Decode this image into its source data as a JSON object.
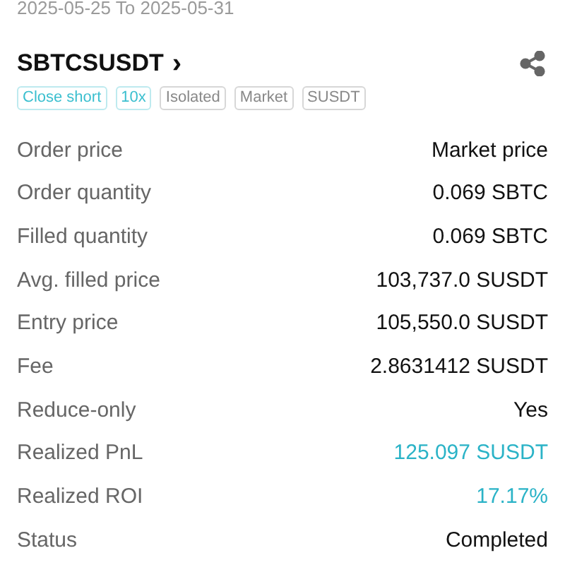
{
  "date_range": "2025-05-25 To 2025-05-31",
  "symbol": "SBTCSUSDT",
  "symbol_arrow": "›",
  "tags": [
    {
      "label": "Close short",
      "color": "#3bbfcf"
    },
    {
      "label": "10x",
      "color": "#3bbfcf"
    },
    {
      "label": "Isolated",
      "color": "#888888"
    },
    {
      "label": "Market",
      "color": "#888888"
    },
    {
      "label": "SUSDT",
      "color": "#888888"
    }
  ],
  "details": [
    {
      "label": "Order price",
      "value": "Market price",
      "kind": "plain"
    },
    {
      "label": "Order quantity",
      "value": "0.069 SBTC",
      "kind": "plain"
    },
    {
      "label": "Filled quantity",
      "value": "0.069 SBTC",
      "kind": "plain"
    },
    {
      "label": "Avg. filled price",
      "value": "103,737.0 SUSDT",
      "kind": "plain"
    },
    {
      "label": "Entry price",
      "value": "105,550.0 SUSDT",
      "kind": "plain"
    },
    {
      "label": "Fee",
      "value": "2.8631412 SUSDT",
      "kind": "plain"
    },
    {
      "label": "Reduce-only",
      "value": "Yes",
      "kind": "plain"
    },
    {
      "label": "Realized PnL",
      "value": "125.097 SUSDT",
      "kind": "positive"
    },
    {
      "label": "Realized ROI",
      "value": "17.17%",
      "kind": "positive"
    },
    {
      "label": "Status",
      "value": "Completed",
      "kind": "plain"
    }
  ]
}
